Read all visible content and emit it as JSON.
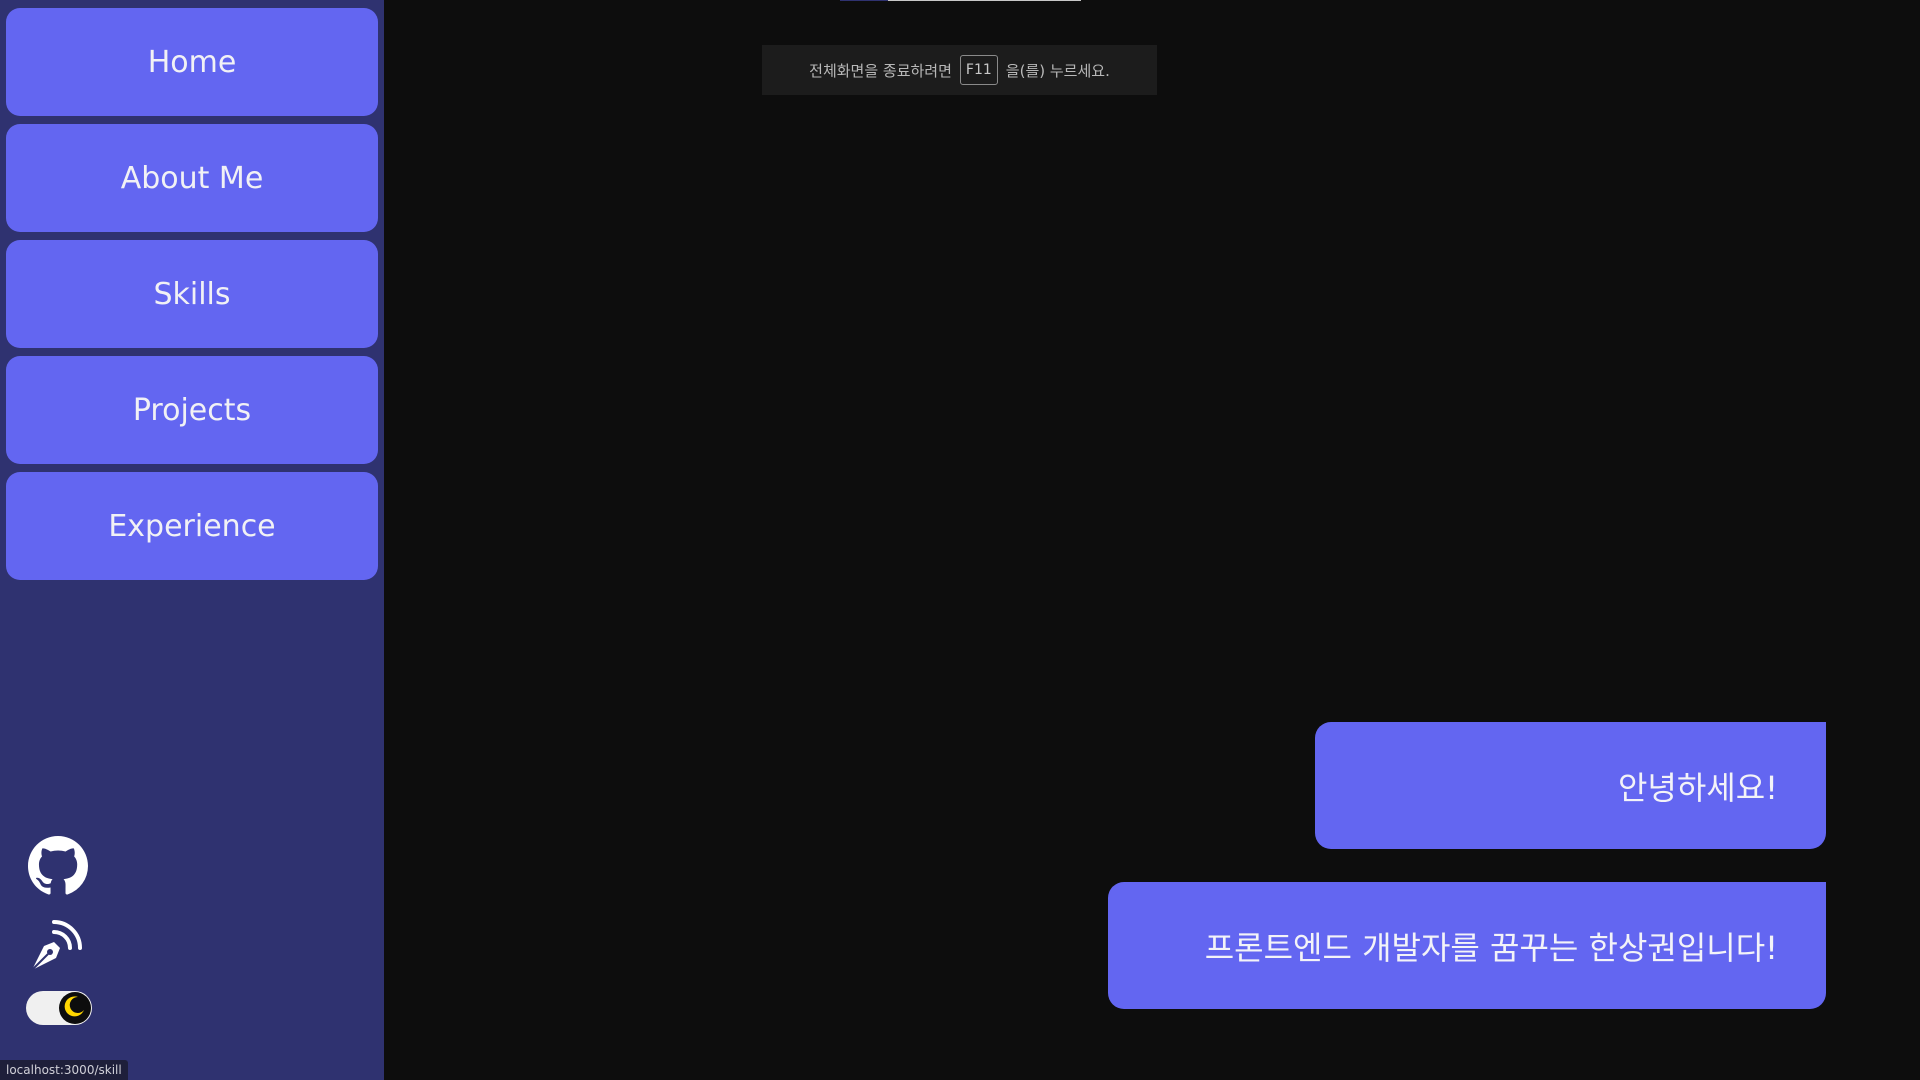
{
  "sidebar": {
    "nav": [
      {
        "label": "Home"
      },
      {
        "label": "About Me"
      },
      {
        "label": "Skills"
      },
      {
        "label": "Projects"
      },
      {
        "label": "Experience"
      }
    ],
    "social": [
      {
        "icon": "github-icon"
      },
      {
        "icon": "blog-feed-pen-icon"
      }
    ],
    "theme_toggle": {
      "state": "dark",
      "icon": "moon-icon"
    }
  },
  "fullscreen_notice": {
    "before": "전체화면을 종료하려면",
    "key": "F11",
    "after": "을(를) 누르세요."
  },
  "messages": [
    {
      "text": "안녕하세요!"
    },
    {
      "text": "프론트엔드 개발자를 꿈꾸는 한상권입니다!"
    }
  ],
  "status_bar": {
    "url": "localhost:3000/skill"
  },
  "colors": {
    "sidebar_bg": "#2f3270",
    "accent": "#6366f1",
    "main_bg": "#0d0d0d"
  }
}
